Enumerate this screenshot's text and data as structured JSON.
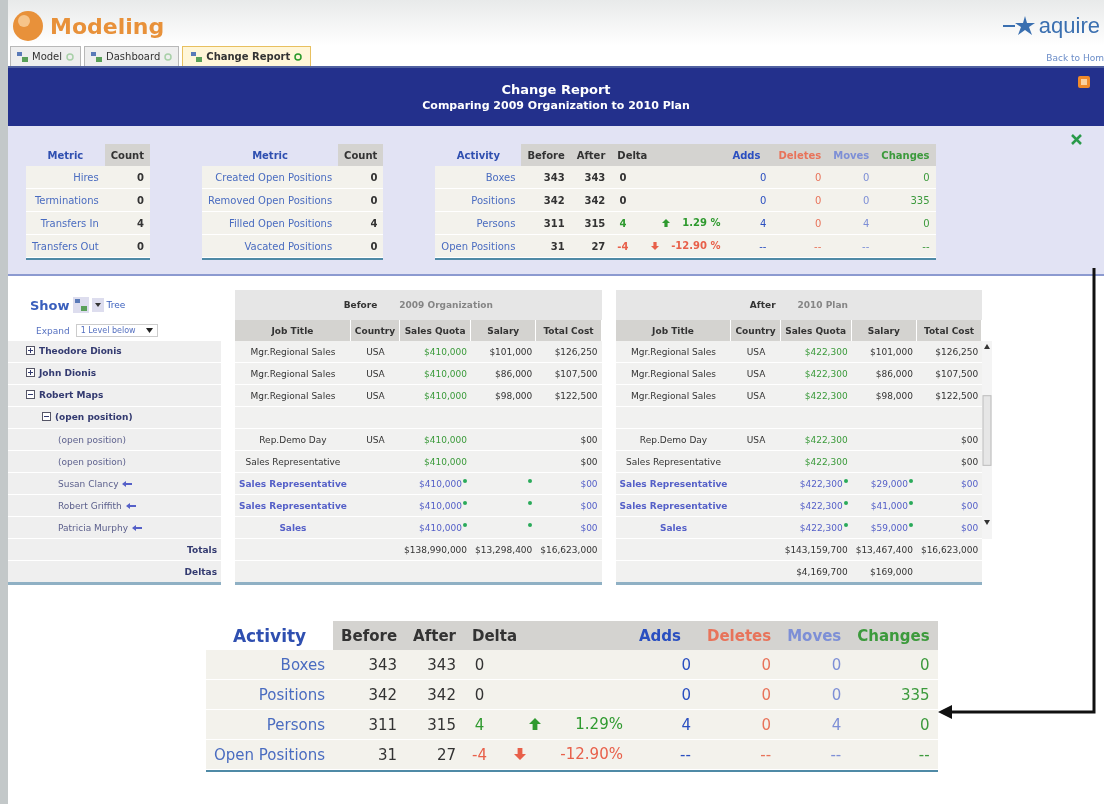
{
  "app": {
    "title": "Modeling",
    "brand": "aquire",
    "back_link": "Back to Hom"
  },
  "tabs": [
    {
      "label": "Model",
      "selected": false
    },
    {
      "label": "Dashboard",
      "selected": false
    },
    {
      "label": "Change Report",
      "selected": true
    }
  ],
  "report": {
    "title": "Change Report",
    "subtitle": "Comparing 2009 Organization to 2010 Plan"
  },
  "metrics": [
    {
      "columns": [
        "Metric",
        "Count"
      ],
      "rows": [
        {
          "label": "Hires",
          "count": "0"
        },
        {
          "label": "Terminations",
          "count": "0"
        },
        {
          "label": "Transfers In",
          "count": "4"
        },
        {
          "label": "Transfers Out",
          "count": "0"
        }
      ]
    },
    {
      "columns": [
        "Metric",
        "Count"
      ],
      "rows": [
        {
          "label": "Created Open Positions",
          "count": "0"
        },
        {
          "label": "Removed Open Positions",
          "count": "0"
        },
        {
          "label": "Filled Open Positions",
          "count": "4"
        },
        {
          "label": "Vacated Positions",
          "count": "0"
        }
      ]
    }
  ],
  "activity": {
    "title": "Activity",
    "columns": [
      "Before",
      "After",
      "Delta"
    ],
    "counts": [
      {
        "label": "Adds",
        "color": "#2a4fc0"
      },
      {
        "label": "Deletes",
        "color": "#e8735a"
      },
      {
        "label": "Moves",
        "color": "#7d8fd6"
      },
      {
        "label": "Changes",
        "color": "#3c9a3c"
      }
    ],
    "rows": [
      {
        "label": "Boxes",
        "before": "343",
        "after": "343",
        "delta": "0",
        "kind": "flat",
        "counts": [
          "0",
          "0",
          "0",
          "0"
        ]
      },
      {
        "label": "Positions",
        "before": "342",
        "after": "342",
        "delta": "0",
        "kind": "flat",
        "counts": [
          "0",
          "0",
          "0",
          "335"
        ]
      },
      {
        "label": "Persons",
        "before": "311",
        "after": "315",
        "delta": "4",
        "kind": "up",
        "pct": "1.29 %",
        "counts": [
          "4",
          "0",
          "4",
          "0"
        ]
      },
      {
        "label": "Open Positions",
        "before": "31",
        "after": "27",
        "delta": "-4",
        "kind": "down",
        "pct": "-12.90 %",
        "counts": [
          "--",
          "--",
          "--",
          "--"
        ]
      }
    ]
  },
  "show": {
    "label": "Show",
    "view": "Tree",
    "expand_label": "Expand",
    "expand_value": "1 Level below"
  },
  "groups": [
    {
      "label": "Before",
      "name": "2009 Organization",
      "columns": [
        "Job Title",
        "Country",
        "Sales Quota",
        "Salary",
        "Total Cost"
      ]
    },
    {
      "label": "After",
      "name": "2010 Plan",
      "columns": [
        "Job Title",
        "Country",
        "Sales Quota",
        "Salary",
        "Total Cost"
      ]
    }
  ],
  "tree": [
    {
      "name": "Theodore Dionis",
      "expanded": false,
      "before": {
        "job_title": "Mgr.Regional Sales",
        "country": "USA",
        "quota": "$410,000",
        "salary": "$101,000",
        "total": "$126,250",
        "changed": false
      },
      "after": {
        "job_title": "Mgr.Regional Sales",
        "country": "USA",
        "quota": "$422,300",
        "salary": "$101,000",
        "total": "$126,250",
        "changed": false
      }
    },
    {
      "name": "John Dionis",
      "expanded": false,
      "before": {
        "job_title": "Mgr.Regional Sales",
        "country": "USA",
        "quota": "$410,000",
        "salary": "$86,000",
        "total": "$107,500",
        "changed": false
      },
      "after": {
        "job_title": "Mgr.Regional Sales",
        "country": "USA",
        "quota": "$422,300",
        "salary": "$86,000",
        "total": "$107,500",
        "changed": false
      }
    },
    {
      "name": "Robert Maps",
      "expanded": true,
      "before": {
        "job_title": "Mgr.Regional Sales",
        "country": "USA",
        "quota": "$410,000",
        "salary": "$98,000",
        "total": "$122,500",
        "changed": false
      },
      "after": {
        "job_title": "Mgr.Regional Sales",
        "country": "USA",
        "quota": "$422,300",
        "salary": "$98,000",
        "total": "$122,500",
        "changed": false
      },
      "children": [
        {
          "name": "(open position)",
          "expanded": true,
          "children": [
            {
              "name": "(open position)",
              "moved": false,
              "before": {
                "job_title": "Rep.Demo Day",
                "country": "USA",
                "quota": "$410,000",
                "total": "$00",
                "changed": false
              },
              "after": {
                "job_title": "Rep.Demo Day",
                "country": "USA",
                "quota": "$422,300",
                "total": "$00",
                "changed": false
              }
            },
            {
              "name": "(open position)",
              "moved": false,
              "before": {
                "job_title": "Sales Representative",
                "quota": "$410,000",
                "total": "$00",
                "changed": false
              },
              "after": {
                "job_title": "Sales Representative",
                "quota": "$422,300",
                "total": "$00",
                "changed": false
              }
            },
            {
              "name": "Susan Clancy",
              "moved": true,
              "before": {
                "job_title": "Sales Representative",
                "quota": "$410,000",
                "total": "$00",
                "changed": true
              },
              "after": {
                "job_title": "Sales Representative",
                "quota": "$422,300",
                "salary": "$29,000",
                "total": "$00",
                "changed": true
              }
            },
            {
              "name": "Robert Griffith",
              "moved": true,
              "before": {
                "job_title": "Sales Representative",
                "quota": "$410,000",
                "total": "$00",
                "changed": true
              },
              "after": {
                "job_title": "Sales Representative",
                "quota": "$422,300",
                "salary": "$41,000",
                "total": "$00",
                "changed": true
              }
            },
            {
              "name": "Patricia Murphy",
              "moved": true,
              "before": {
                "job_title": "Sales",
                "quota": "$410,000",
                "total": "$00",
                "changed": true
              },
              "after": {
                "job_title": "Sales",
                "quota": "$422,300",
                "salary": "$59,000",
                "total": "$00",
                "changed": true
              }
            }
          ]
        }
      ]
    }
  ],
  "totals": {
    "label": "Totals",
    "before": [
      "$138,990,000",
      "$13,298,400",
      "$16,623,000"
    ],
    "after": [
      "$143,159,700",
      "$13,467,400",
      "$16,623,000"
    ]
  },
  "deltas": {
    "label": "Deltas",
    "after": [
      "$4,169,700",
      "$169,000"
    ]
  },
  "activity_zoom": {
    "title": "Activity",
    "columns": [
      "Before",
      "After",
      "Delta"
    ],
    "counts": [
      {
        "label": "Adds",
        "color": "#2a4fc0"
      },
      {
        "label": "Deletes",
        "color": "#e8735a"
      },
      {
        "label": "Moves",
        "color": "#7d8fd6"
      },
      {
        "label": "Changes",
        "color": "#3c9a3c"
      }
    ],
    "rows": [
      {
        "label": "Boxes",
        "before": "343",
        "after": "343",
        "delta": "0",
        "kind": "flat",
        "counts": [
          "0",
          "0",
          "0",
          "0"
        ]
      },
      {
        "label": "Positions",
        "before": "342",
        "after": "342",
        "delta": "0",
        "kind": "flat",
        "counts": [
          "0",
          "0",
          "0",
          "335"
        ]
      },
      {
        "label": "Persons",
        "before": "311",
        "after": "315",
        "delta": "4",
        "kind": "up",
        "pct": "1.29%",
        "counts": [
          "4",
          "0",
          "4",
          "0"
        ]
      },
      {
        "label": "Open Positions",
        "before": "31",
        "after": "27",
        "delta": "-4",
        "kind": "down",
        "pct": "-12.90%",
        "counts": [
          "--",
          "--",
          "--",
          "--"
        ]
      }
    ]
  }
}
